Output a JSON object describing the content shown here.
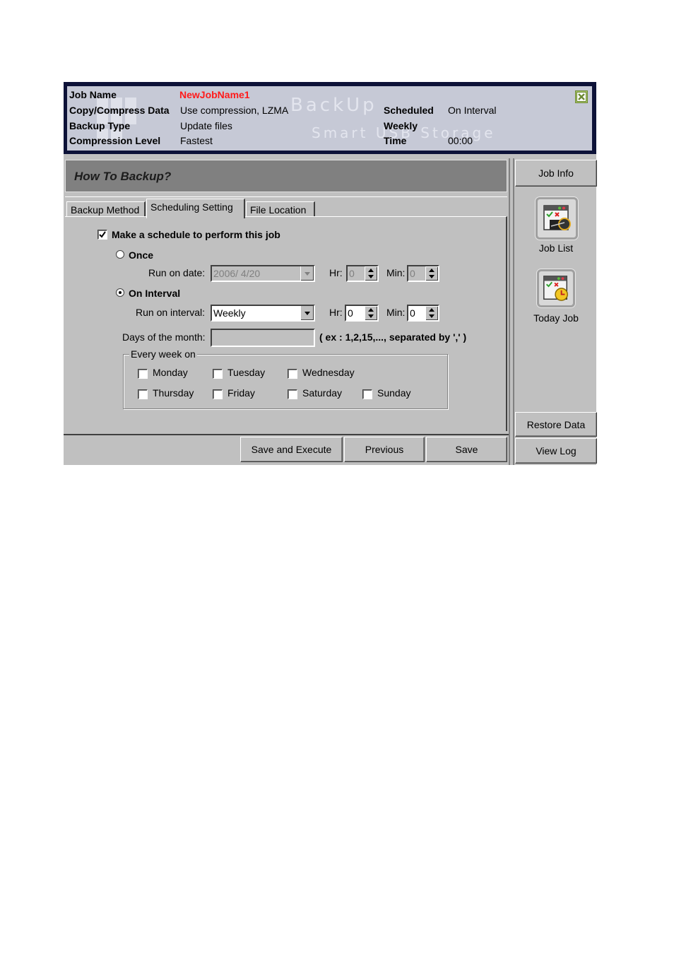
{
  "header": {
    "watermark": {
      "brand": "level one",
      "line1": "BackUp",
      "line2": "Smart USB Storage"
    },
    "job_name_label": "Job Name",
    "job_name_value": "NewJobName1",
    "copy_label": "Copy/Compress Data",
    "copy_value": "Use compression, LZMA",
    "backup_type_label": "Backup Type",
    "backup_type_value": "Update files",
    "compression_label": "Compression Level",
    "compression_value": "Fastest",
    "scheduled_label": "Scheduled",
    "scheduled_value": "On Interval",
    "weekly_label": "Weekly",
    "time_label": "Time",
    "time_value": "00:00",
    "close_icon": "close-icon"
  },
  "main": {
    "title": "How To Backup?",
    "tabs": [
      {
        "label": "Backup Method",
        "active": false
      },
      {
        "label": "Scheduling Setting",
        "active": true
      },
      {
        "label": "File Location",
        "active": false
      }
    ],
    "schedule": {
      "make_schedule_label": "Make a schedule to perform this job",
      "make_schedule_checked": true,
      "once_label": "Once",
      "once_selected": false,
      "run_on_date_label": "Run on date:",
      "run_on_date_value": "2006/  4/20",
      "hr_label": "Hr:",
      "min_label": "Min:",
      "once_hr": "0",
      "once_min": "0",
      "interval_label": "On Interval",
      "interval_selected": true,
      "run_on_interval_label": "Run on interval:",
      "run_on_interval_value": "Weekly",
      "interval_hr": "0",
      "interval_min": "0",
      "days_of_month_label": "Days of the month:",
      "days_of_month_value": "",
      "days_hint": "( ex : 1,2,15,..., separated by ',' )",
      "every_week_label": "Every week on",
      "days": [
        {
          "label": "Monday",
          "checked": false
        },
        {
          "label": "Tuesday",
          "checked": false
        },
        {
          "label": "Wednesday",
          "checked": false
        },
        {
          "label": "Thursday",
          "checked": false
        },
        {
          "label": "Friday",
          "checked": false
        },
        {
          "label": "Saturday",
          "checked": false
        },
        {
          "label": "Sunday",
          "checked": false
        }
      ]
    },
    "buttons": {
      "save_execute": "Save and Execute",
      "previous": "Previous",
      "save": "Save"
    }
  },
  "side": {
    "job_info": "Job Info",
    "job_list": "Job List",
    "today_job": "Today Job",
    "restore_data": "Restore Data",
    "view_log": "View Log"
  }
}
